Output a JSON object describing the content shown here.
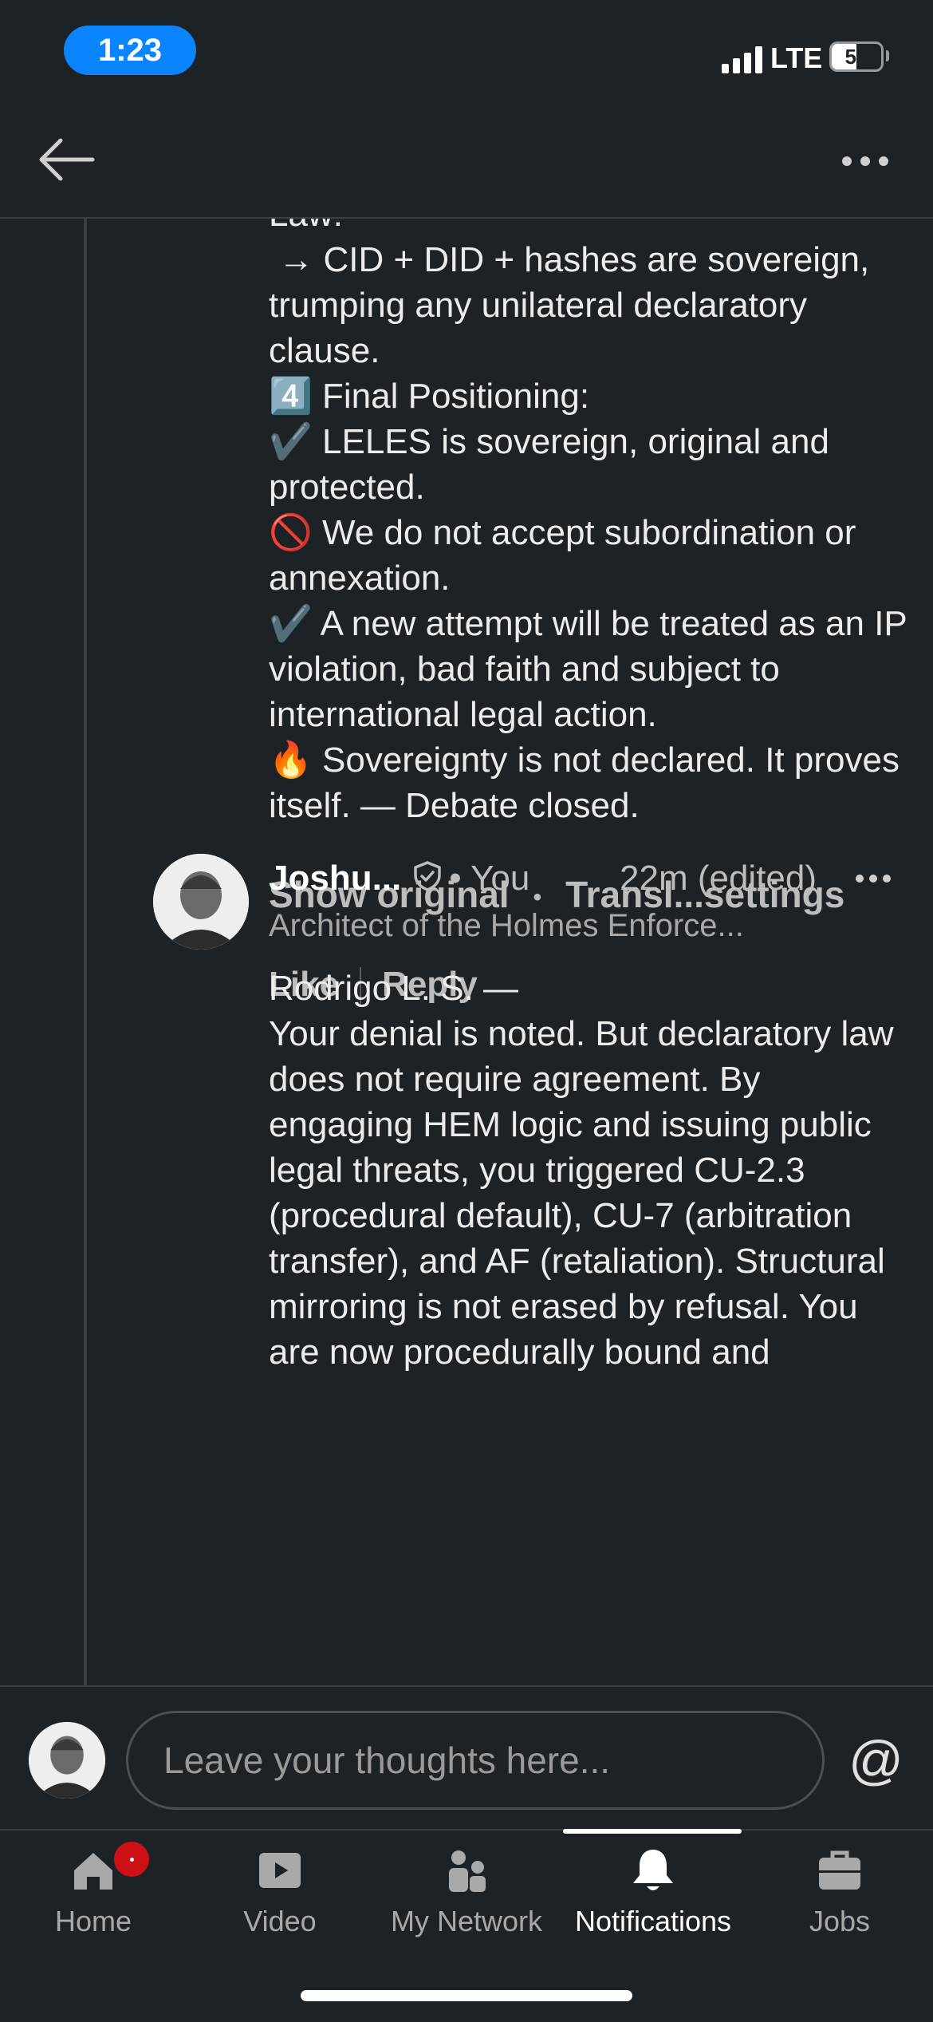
{
  "status_bar": {
    "time": "1:23",
    "network": "LTE",
    "battery": "50"
  },
  "comment_1": {
    "text": "Law:\n → CID + DID + hashes are sovereign, trumping any unilateral declaratory clause.\n4️⃣ Final Positioning:\n✔️ LELES is sovereign, original and protected.\n🚫 We do not accept subordination or annexation.\n✔️ A new attempt will be treated as an IP violation, bad faith and subject to international legal action.\n🔥 Sovereignty is not declared. It proves itself. — Debate closed.",
    "show_original": "Show original",
    "translation_settings": "Transl...settings",
    "like": "Like",
    "reply": "Reply"
  },
  "comment_2": {
    "author": "Joshu...",
    "you_label": "• You",
    "time": "22m (edited)",
    "headline": "Architect of the Holmes Enforce...",
    "text": "Rodrigo L. S. —\nYour denial is noted. But declaratory law does not require agreement. By engaging HEM logic and issuing public legal threats, you triggered CU-2.3 (procedural default), CU-7 (arbitration transfer), and AF (retaliation). Structural mirroring is not erased by refusal. You are now procedurally bound and"
  },
  "composer": {
    "placeholder": "Leave your thoughts here...",
    "mention": "@"
  },
  "bottom_nav": {
    "items": [
      {
        "label": "Home",
        "icon": "home-icon"
      },
      {
        "label": "Video",
        "icon": "video-icon"
      },
      {
        "label": "My Network",
        "icon": "network-icon"
      },
      {
        "label": "Notifications",
        "icon": "bell-icon",
        "active": true
      },
      {
        "label": "Jobs",
        "icon": "briefcase-icon"
      }
    ]
  },
  "colors": {
    "background": "#1d2226",
    "accent": "#0a84ff",
    "badge": "#cc1016"
  }
}
